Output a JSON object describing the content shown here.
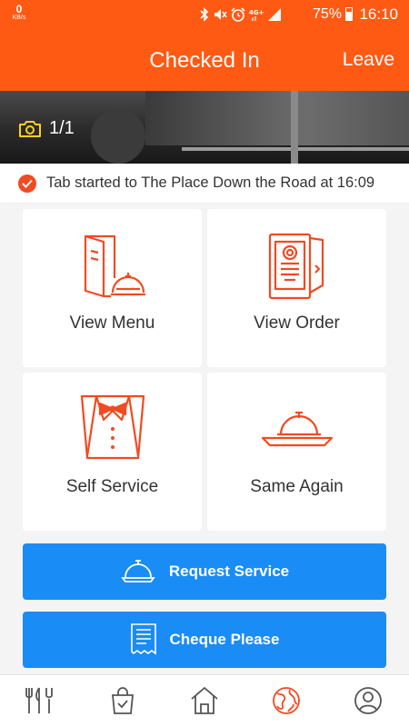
{
  "status_bar": {
    "net_speed": "0",
    "net_unit": "KB/s",
    "battery": "75%",
    "time": "16:10",
    "icons": [
      "bluetooth-icon",
      "mute-icon",
      "alarm-icon",
      "4g-icon",
      "signal-icon",
      "battery-icon"
    ]
  },
  "header": {
    "title": "Checked In",
    "leave_label": "Leave"
  },
  "hero": {
    "photo_counter": "1/1"
  },
  "notice": {
    "text": "Tab started to The Place Down the Road at 16:09"
  },
  "tiles": [
    {
      "label": "View Menu",
      "icon": "menu-icon"
    },
    {
      "label": "View Order",
      "icon": "order-icon"
    },
    {
      "label": "Self Service",
      "icon": "waiter-icon"
    },
    {
      "label": "Same Again",
      "icon": "cloche-icon"
    }
  ],
  "buttons": {
    "request_service": "Request Service",
    "cheque_please": "Cheque Please"
  },
  "tabbar": {
    "items": [
      "cutlery-icon",
      "shopping-bag-icon",
      "home-icon",
      "globe-icon",
      "profile-icon"
    ],
    "active": "globe-icon"
  },
  "colors": {
    "brand_orange": "#ff5a14",
    "icon_red": "#f24a21",
    "button_blue": "#1a8cf5"
  }
}
